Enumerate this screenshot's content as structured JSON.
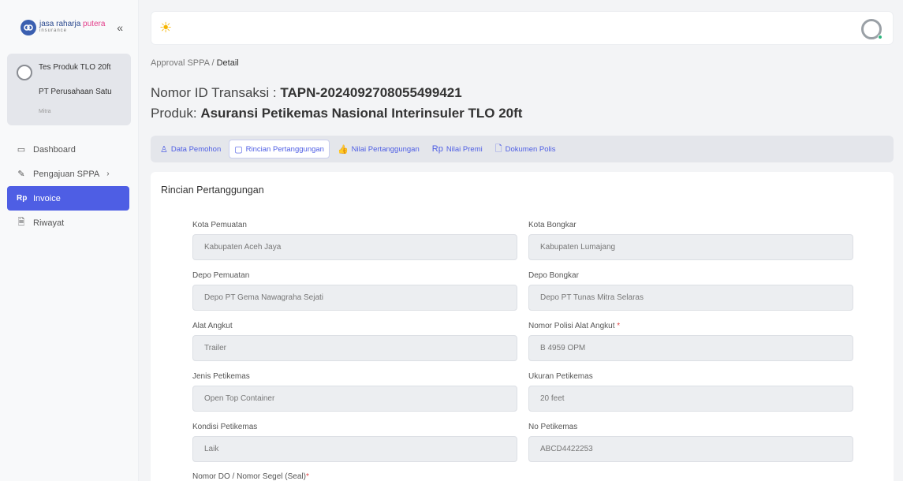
{
  "logo": {
    "brand_a": "jasa raharja",
    "brand_b": "putera",
    "sub": "insurance",
    "collapse": "«"
  },
  "profile": {
    "name": "Tes Produk TLO 20ft",
    "company": "PT Perusahaan Satu",
    "role": "Mitra"
  },
  "nav": [
    {
      "label": "Dashboard",
      "icon": "monitor-icon",
      "glyph": "▭"
    },
    {
      "label": "Pengajuan SPPA",
      "icon": "pencil-icon",
      "glyph": "✎",
      "chevron": "›"
    },
    {
      "label": "Invoice",
      "icon": "rupiah-icon",
      "glyph": "Rp",
      "active": true
    },
    {
      "label": "Riwayat",
      "icon": "document-icon",
      "glyph": "🗎"
    }
  ],
  "breadcrumb": {
    "parent": "Approval SPPA",
    "sep": " / ",
    "current": "Detail"
  },
  "header": {
    "trx_label": "Nomor ID Transaksi : ",
    "trx_value": "TAPN-2024092708055499421",
    "product_label": "Produk: ",
    "product_value": "Asuransi Petikemas Nasional Interinsuler TLO 20ft"
  },
  "tabs": [
    {
      "label": "Data Pemohon",
      "icon": "user-icon",
      "glyph": "♙"
    },
    {
      "label": "Rincian Pertanggungan",
      "icon": "clipboard-icon",
      "glyph": "▢",
      "active": true
    },
    {
      "label": "Nilai Pertanggungan",
      "icon": "thumbs-up-icon",
      "glyph": "👍"
    },
    {
      "label": "Nilai Premi",
      "icon": "rupiah-icon",
      "glyph": "Rp"
    },
    {
      "label": "Dokumen Polis",
      "icon": "file-icon",
      "glyph": "🗋"
    }
  ],
  "card": {
    "title": "Rincian Pertanggungan",
    "fields": {
      "kota_pemuatan": {
        "label": "Kota Pemuatan",
        "value": "Kabupaten Aceh Jaya"
      },
      "kota_bongkar": {
        "label": "Kota Bongkar",
        "value": "Kabupaten Lumajang"
      },
      "depo_pemuatan": {
        "label": "Depo Pemuatan",
        "value": "Depo PT Gema Nawagraha Sejati"
      },
      "depo_bongkar": {
        "label": "Depo Bongkar",
        "value": "Depo PT Tunas Mitra Selaras"
      },
      "alat_angkut": {
        "label": "Alat Angkut",
        "value": "Trailer"
      },
      "nomor_polisi": {
        "label": "Nomor Polisi Alat Angkut ",
        "required": "*",
        "value": "B 4959 OPM"
      },
      "jenis_petikemas": {
        "label": "Jenis Petikemas",
        "value": "Open Top Container"
      },
      "ukuran_petikemas": {
        "label": "Ukuran Petikemas",
        "value": "20 feet"
      },
      "kondisi_petikemas": {
        "label": "Kondisi Petikemas",
        "value": "Laik"
      },
      "no_petikemas": {
        "label": "No Petikemas",
        "value": "ABCD4422253"
      },
      "nomor_do": {
        "label": "Nomor DO / Nomor Segel (Seal)",
        "required": "*"
      }
    }
  },
  "colors": {
    "accent": "#4e5ee4",
    "required": "#e24545",
    "status_online": "#2cb67d"
  }
}
